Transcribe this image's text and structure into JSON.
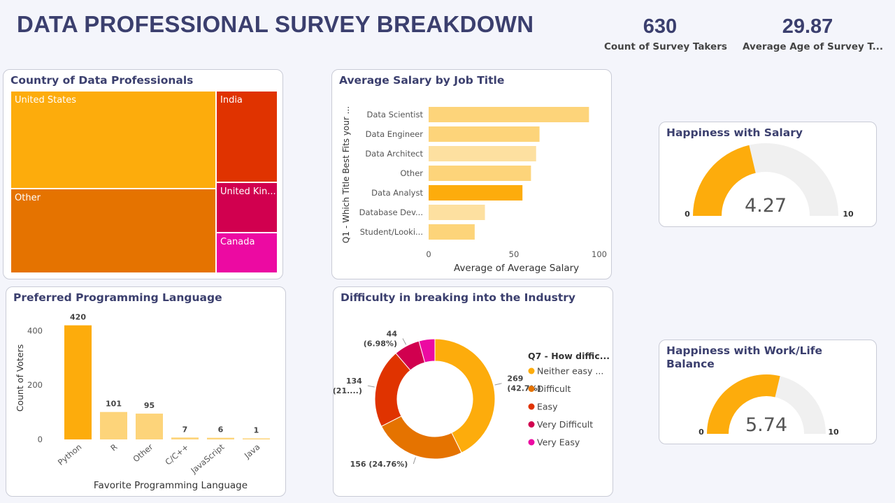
{
  "dashboard": {
    "title": "DATA PROFESSIONAL SURVEY BREAKDOWN",
    "kpis": [
      {
        "value": "630",
        "label": "Count of Survey Takers"
      },
      {
        "value": "29.87",
        "label": "Average Age of Survey T..."
      }
    ]
  },
  "colors": {
    "orange": "#fdac0c",
    "dark_orange": "#e57300",
    "red": "#e03300",
    "crimson": "#d1004f",
    "pink": "#ec0aa2",
    "light": "#fdd47a",
    "gauge_bg": "#f0f0f0"
  },
  "chart_data": [
    {
      "id": "country",
      "type": "treemap",
      "title": "Country of Data Professionals",
      "items": [
        {
          "label": "United States"
        },
        {
          "label": "Other"
        },
        {
          "label": "India"
        },
        {
          "label": "United Kin..."
        },
        {
          "label": "Canada"
        }
      ]
    },
    {
      "id": "salary",
      "type": "bar",
      "orientation": "horizontal",
      "title": "Average Salary by Job Title",
      "ylabel": "Q1 - Which Title Best Fits your ...",
      "xlabel": "Average of Average Salary",
      "categories": [
        "Data Scientist",
        "Data Engineer",
        "Data Architect",
        "Other",
        "Data Analyst",
        "Database Dev...",
        "Student/Looki..."
      ],
      "values": [
        94,
        65,
        63,
        60,
        55,
        33,
        27
      ],
      "xlim": [
        0,
        100
      ],
      "ticks": [
        "0",
        "50",
        "100"
      ]
    },
    {
      "id": "happiness_salary",
      "type": "gauge",
      "title": "Happiness with Salary",
      "value": 4.27,
      "value_label": "4.27",
      "min_label": "0",
      "max_label": "10",
      "range": [
        0,
        10
      ]
    },
    {
      "id": "language",
      "type": "bar",
      "title": "Preferred Programming Language",
      "ylabel": "Count of Voters",
      "xlabel": "Favorite Programming Language",
      "categories": [
        "Python",
        "R",
        "Other",
        "C/C++",
        "JavaScript",
        "Java"
      ],
      "values": [
        420,
        101,
        95,
        7,
        6,
        1
      ],
      "value_labels": [
        "420",
        "101",
        "95",
        "7",
        "6",
        "1"
      ],
      "ylim": [
        0,
        450
      ],
      "ticks": [
        "0",
        "200",
        "400"
      ]
    },
    {
      "id": "difficulty",
      "type": "pie",
      "title": "Difficulty in breaking into the Industry",
      "legend_title": "Q7 - How diffic...",
      "categories": [
        "Neither easy ...",
        "Difficult",
        "Easy",
        "Very Difficult",
        "Very Easy"
      ],
      "values": [
        269,
        156,
        134,
        44,
        27
      ],
      "labels": [
        [
          "269",
          "(42.7%)"
        ],
        [
          "156 (24.76%)"
        ],
        [
          "134",
          "(21....)"
        ],
        [
          "44",
          "(6.98%)"
        ],
        []
      ]
    },
    {
      "id": "happiness_worklife",
      "type": "gauge",
      "title": "Happiness with Work/Life Balance",
      "title_lines": [
        "Happiness with Work/Life",
        "Balance"
      ],
      "value": 5.74,
      "value_label": "5.74",
      "min_label": "0",
      "max_label": "10",
      "range": [
        0,
        10
      ]
    }
  ]
}
